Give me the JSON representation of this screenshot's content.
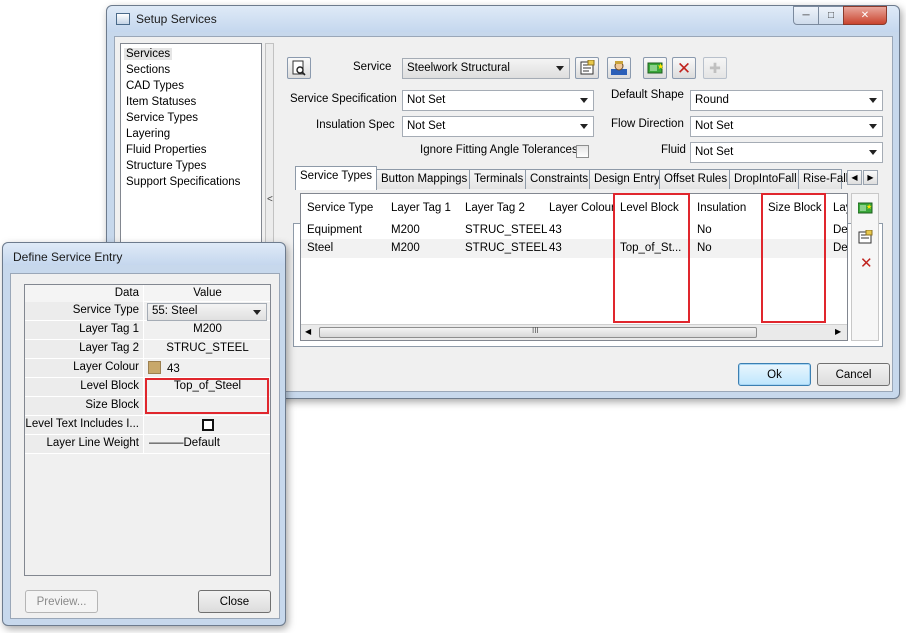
{
  "setup": {
    "title": "Setup Services",
    "nav": [
      "Services",
      "Sections",
      "CAD Types",
      "Item Statuses",
      "Service Types",
      "Layering",
      "Fluid Properties",
      "Structure Types",
      "Support Specifications"
    ],
    "splitter_glyph": "<",
    "service_label": "Service",
    "service_value": "Steelwork Structural",
    "spec_label": "Service Specification",
    "spec_value": "Not Set",
    "insulation_label": "Insulation Spec",
    "insulation_value": "Not Set",
    "shape_label": "Default Shape",
    "shape_value": "Round",
    "flow_label": "Flow Direction",
    "flow_value": "Not Set",
    "fluid_label": "Fluid",
    "fluid_value": "Not Set",
    "ignore_label": "Ignore Fitting Angle Tolerances",
    "ignore_checked": false,
    "tabs": [
      "Service Types",
      "Button Mappings",
      "Terminals",
      "Constraints",
      "Design Entry",
      "Offset Rules",
      "DropIntoFall",
      "Rise-Fall"
    ],
    "columns": [
      "Service Type",
      "Layer Tag 1",
      "Layer Tag 2",
      "Layer Colour",
      "Level Block",
      "Insulation",
      "Size Block",
      "Lay"
    ],
    "rows": [
      [
        "Equipment",
        "M200",
        "STRUC_STEEL",
        "43",
        "",
        "No",
        "",
        "De"
      ],
      [
        "Steel",
        "M200",
        "STRUC_STEEL",
        "43",
        "Top_of_St...",
        "No",
        "",
        "De"
      ]
    ],
    "ok": "Ok",
    "cancel": "Cancel",
    "scroll_grip": "III"
  },
  "define": {
    "title": "Define Service Entry",
    "head_key": "Data",
    "head_value": "Value",
    "props": [
      {
        "key": "Service Type",
        "value": "55: Steel"
      },
      {
        "key": "Layer Tag 1",
        "value": "M200"
      },
      {
        "key": "Layer Tag 2",
        "value": "STRUC_STEEL"
      },
      {
        "key": "Layer Colour",
        "value": "43"
      },
      {
        "key": "Level Block",
        "value": "Top_of_Steel"
      },
      {
        "key": "Size Block",
        "value": ""
      },
      {
        "key": "Level Text Includes I...",
        "value": ""
      },
      {
        "key": "Layer Line Weight",
        "value": "———Default"
      }
    ],
    "preview": "Preview...",
    "close": "Close"
  },
  "colors": {
    "highlight": "#e0262d",
    "layer_colour_swatch": "#c8a86b",
    "ok_border": "#3c7fb1"
  }
}
